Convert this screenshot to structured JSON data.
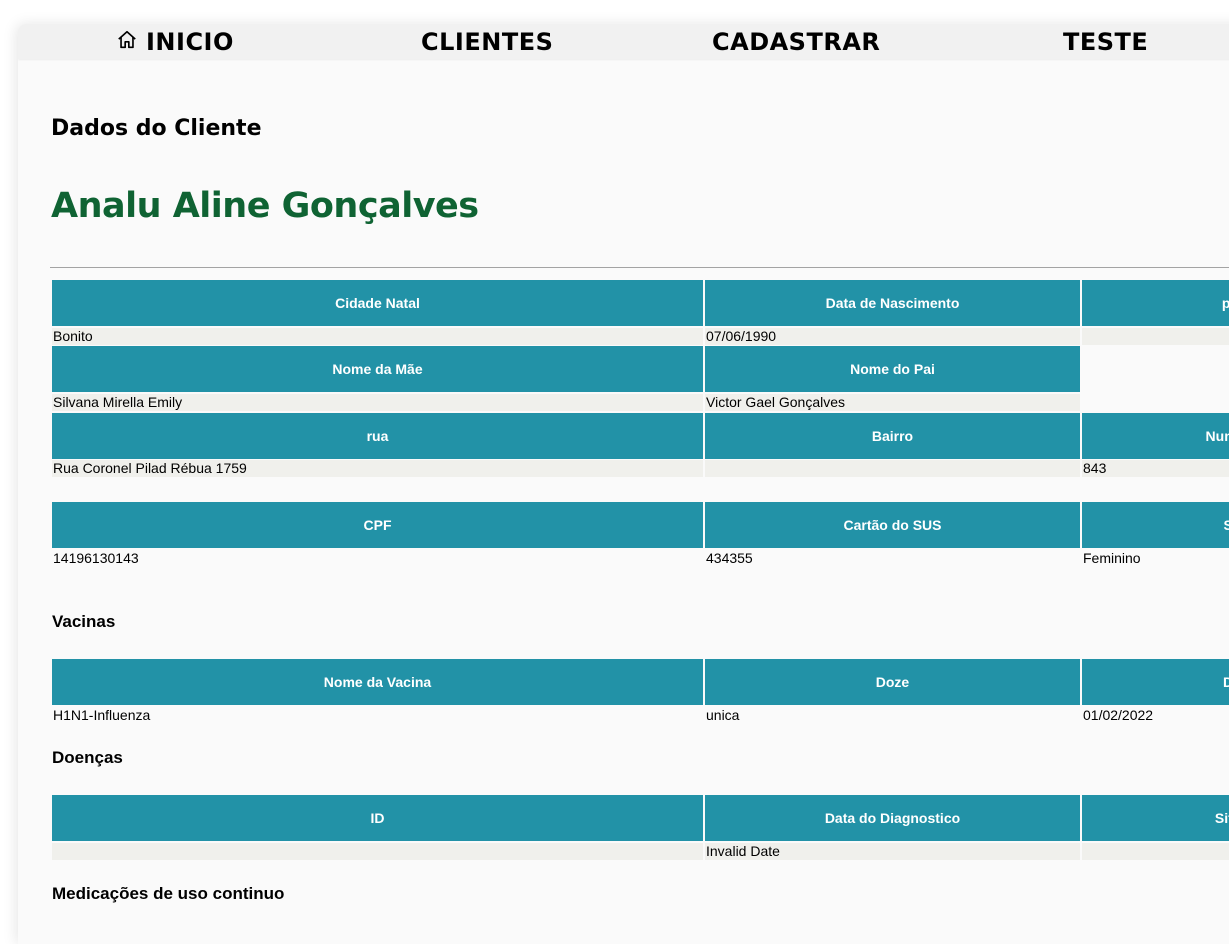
{
  "nav": {
    "home_label": "INICIO",
    "clients_label": "CLIENTES",
    "register_label": "CADASTRAR",
    "test_label": "TESTE"
  },
  "page": {
    "heading": "Dados do Cliente",
    "client_name": "Analu Aline Gonçalves"
  },
  "info_table_1": {
    "headers": [
      "Cidade Natal",
      "Data de Nascimento",
      "pla"
    ],
    "values": [
      "Bonito",
      "07/06/1990",
      ""
    ]
  },
  "info_table_2": {
    "headers": [
      "Nome da Mãe",
      "Nome do Pai"
    ],
    "values": [
      "Silvana Mirella Emily",
      "Victor Gael Gonçalves"
    ]
  },
  "address_table": {
    "headers": [
      "rua",
      "Bairro",
      "Numero"
    ],
    "values": [
      "Rua Coronel Pilad Rébua 1759",
      "",
      "843"
    ]
  },
  "docs_table": {
    "headers": [
      "CPF",
      "Cartão do SUS",
      "Se"
    ],
    "values": [
      "14196130143",
      "434355",
      "Feminino"
    ]
  },
  "vaccines": {
    "title": "Vacinas",
    "headers": [
      "Nome da Vacina",
      "Doze",
      "Da"
    ],
    "rows": [
      [
        "H1N1-Influenza",
        "unica",
        "01/02/2022"
      ]
    ]
  },
  "diseases": {
    "title": "Doenças",
    "headers": [
      "ID",
      "Data do Diagnostico",
      "Situa"
    ],
    "rows": [
      [
        "",
        "Invalid Date",
        ""
      ]
    ]
  },
  "medications": {
    "title": "Medicações de uso continuo"
  },
  "colors": {
    "header_bg": "#2292a7",
    "client_name": "#0f6333",
    "row_bg": "#f0f0ec"
  }
}
